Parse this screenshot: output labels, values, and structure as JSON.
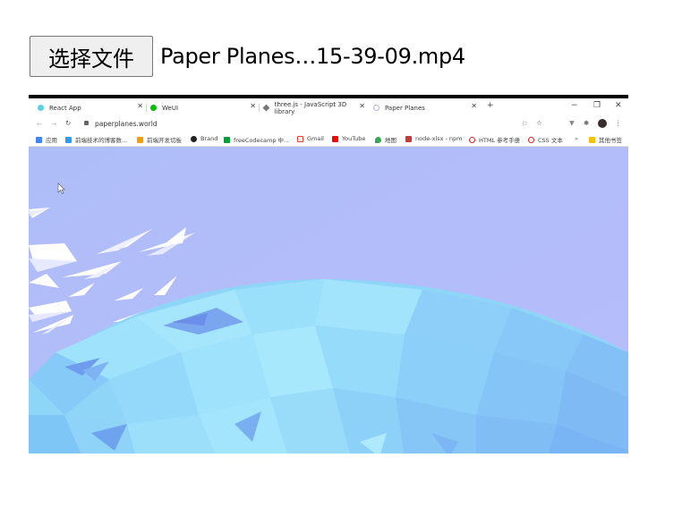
{
  "file_input": {
    "button_label": "选择文件",
    "file_name": "Paper Planes…15-39-09.mp4"
  },
  "video_frame": {
    "browser_tabs": [
      {
        "label": "React App",
        "color": "#5ccfe6"
      },
      {
        "label": "WeUI",
        "color": "#09bb07"
      },
      {
        "label": "three.js - JavaScript 3D library",
        "color": "#777777"
      },
      {
        "label": "Paper Planes",
        "color": "#b9b3f5"
      }
    ],
    "new_tab": "+",
    "window_controls": {
      "minimize": "−",
      "restore": "❐",
      "close": "✕"
    },
    "address": "paperplanes.world",
    "bookmarks": [
      {
        "label": "应用",
        "color": "#4285f4"
      },
      {
        "label": "前端技术的博客数...",
        "color": "#2a9df4"
      },
      {
        "label": "前端开发切板",
        "color": "#ff9c00"
      },
      {
        "label": "Brand",
        "color": "#222222"
      },
      {
        "label": "freeCodecamp 中...",
        "color": "#0a9b3c"
      },
      {
        "label": "Gmail",
        "color": "#ea4335"
      },
      {
        "label": "YouTube",
        "color": "#ff0000"
      },
      {
        "label": "地图",
        "color": "#34a853"
      },
      {
        "label": "node-xlsx - npm",
        "color": "#cb3837"
      },
      {
        "label": "HTML 参考手册",
        "color": "#d22"
      },
      {
        "label": "CSS 文本",
        "color": "#d22"
      },
      {
        "label": "其他书签",
        "color": "#f4c20d"
      }
    ],
    "bookmark_more": "»"
  }
}
